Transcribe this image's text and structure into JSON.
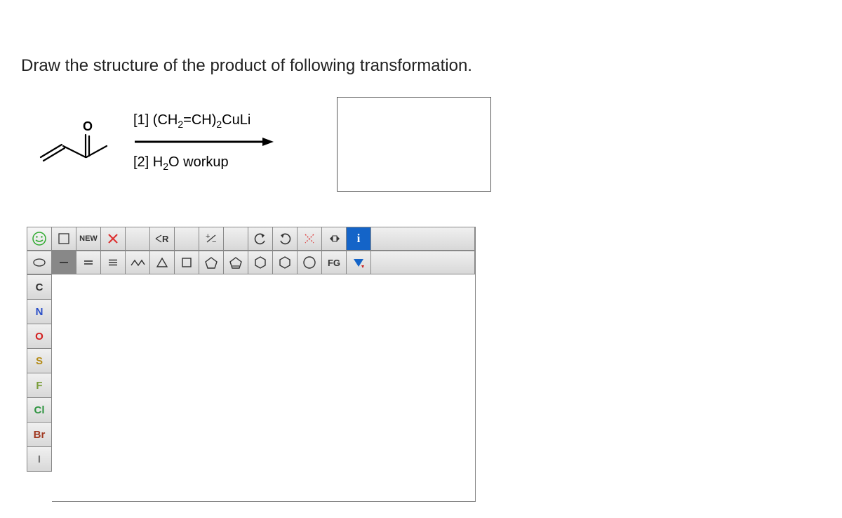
{
  "prompt": "Draw the structure of the product of following transformation.",
  "reaction": {
    "reactant_label": "alpha,beta-unsaturated methyl ketone",
    "condition1_html": "[1] (CH₂=CH)₂CuLi",
    "condition2_html": "[2] H₂O workup"
  },
  "toolbar_top": {
    "smile": "smile-icon",
    "marquee": "marquee-icon",
    "new": "NEW",
    "delete": "delete-icon",
    "rgroup": "R",
    "charge": "±",
    "undo": "undo-icon",
    "redo": "redo-icon",
    "cut": "cut-icon",
    "resize": "resize-icon",
    "info": "i"
  },
  "toolbar_row2": {
    "lasso": "lasso-icon",
    "single": "single-bond",
    "double": "double-bond",
    "triple": "triple-bond",
    "chain": "chain-bond",
    "ring3": "ring-3",
    "ring4": "ring-4",
    "ring5": "ring-5",
    "ring55": "ring-5b",
    "ring6": "ring-6",
    "ring6b": "ring-6b",
    "ring7": "ring-7",
    "fg": "FG",
    "more": "more"
  },
  "elements": [
    "C",
    "N",
    "O",
    "S",
    "F",
    "Cl",
    "Br",
    "I"
  ]
}
